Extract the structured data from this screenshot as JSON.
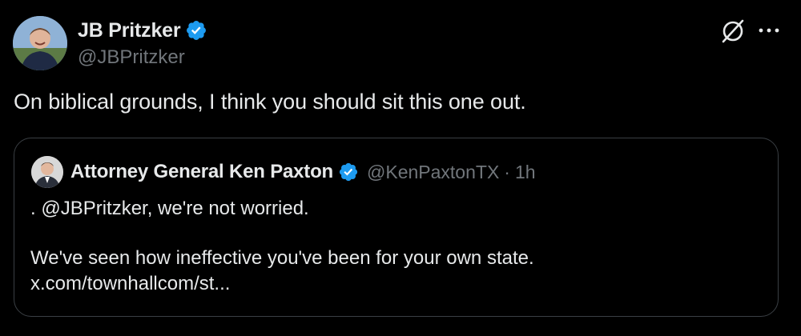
{
  "tweet": {
    "author": {
      "display_name": "JB Pritzker",
      "handle": "@JBPritzker",
      "verified": true
    },
    "text": "On biblical grounds, I think you should sit this one out.",
    "icons": {
      "grok": "grok-icon",
      "more": "more-icon",
      "verified": "verified-badge-icon"
    }
  },
  "quoted_tweet": {
    "author": {
      "display_name": "Attorney General Ken Paxton",
      "handle": "@KenPaxtonTX",
      "verified": true
    },
    "separator": "·",
    "time": "1h",
    "lines": [
      ". @JBPritzker, we're not worried.",
      "We've seen how ineffective you've been for your own state.",
      "x.com/townhallcom/st..."
    ]
  },
  "colors": {
    "background": "#000000",
    "text_primary": "#e7e9ea",
    "text_secondary": "#71767b",
    "verified_blue": "#1d9bf0",
    "border": "#3a3f44"
  }
}
